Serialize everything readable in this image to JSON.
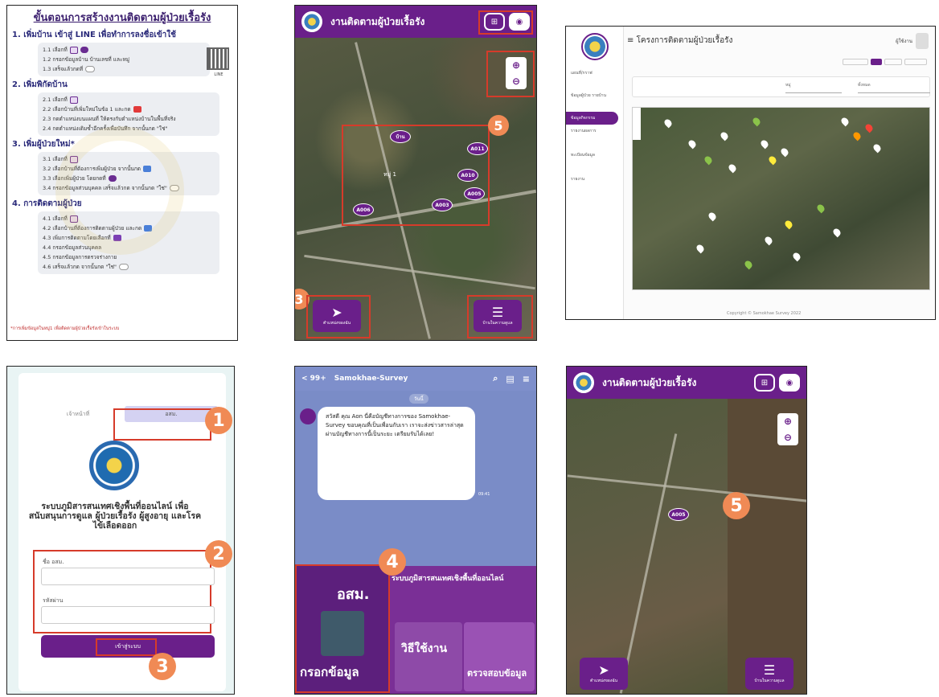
{
  "panel1": {
    "title": "ขั้นตอนการสร้างงานติดตามผู้ป่วยเรื้อรัง",
    "sections": [
      {
        "heading": "1. เพิ่มบ้าน เข้าสู่ LINE เพื่อทำการลงชื่อเข้าใช้",
        "steps": [
          "1.1 เลือกที่",
          "1.2 กรอกข้อมูลบ้าน บ้านเลขที่ และหมู่",
          "1.3 เสร็จแล้วกดที่"
        ]
      },
      {
        "heading": "2. เพิ่มพิกัดบ้าน",
        "steps": [
          "2.1 เลือกที่",
          "2.2 เลือกบ้านที่เพิ่มใหม่ในข้อ 1 และกด",
          "2.3 กดตำแหน่งบนแผนที่ ให้ตรงกับตำแหน่งบ้านในพื้นที่จริง",
          "2.4 กดตำแหน่งเดิมซ้ำอีกครั้งเพื่อบันทึก จากนั้นกด \"ใช่\""
        ]
      },
      {
        "heading": "3. เพิ่มผู้ป่วยใหม่*",
        "steps": [
          "3.1 เลือกที่",
          "3.2 เลือกบ้านที่ต้องการเพิ่มผู้ป่วย จากนั้นกด",
          "3.3 เลือกเพิ่มผู้ป่วย โดยกดที่",
          "3.4 กรอกข้อมูลส่วนบุคคล เสร็จแล้วกด จากนั้นกด \"ใช่\""
        ]
      },
      {
        "heading": "4. การติดตามผู้ป่วย",
        "steps": [
          "4.1 เลือกที่",
          "4.2 เลือกบ้านที่ต้องการติดตามผู้ป่วย และกด",
          "4.3 เพิ่มการติดตามโดยเลือกที่",
          "4.4 กรอกข้อมูลส่วนบุคคล",
          "4.5 กรอกข้อมูลการตรวจร่างกาย",
          "4.6 เสร็จแล้วกด จากนั้นกด \"ใช่\""
        ]
      }
    ],
    "footnote": "*การเพิ่มข้อมูลในหมู่1 เพื่อติดตามผู้ป่วยเรื้อรังเข้าในระบบ"
  },
  "panel2": {
    "app_title": "งานติดตามผู้ป่วยเรื้อรัง",
    "village_label": "หมู่ 1",
    "pins": [
      "บ้าน",
      "A011",
      "A010",
      "A005",
      "A003",
      "A006"
    ],
    "badges": [
      "5",
      "3"
    ],
    "nav_left": "ตำแหน่งของฉัน",
    "nav_right": "บ้านในความดูแล"
  },
  "panel3": {
    "header": "โครงการติดตามผู้ป่วยเรื้อรัง",
    "menu": [
      "แผนที่/กราฟ",
      "ข้อมูลผู้ป่วย รายบ้าน",
      "ข้อมูลกิจกรรม",
      "รายงานผลการ",
      "ทะเบียนข้อมูล",
      "รายงาน"
    ],
    "filter1": "หมู่",
    "filter2": "ทั้งหมด",
    "footer": "Copyright © Samokhae Survey 2022"
  },
  "panel4": {
    "tab1": "เจ้าหน้าที่",
    "tab2": "อสม.",
    "title": "ระบบภูมิสารสนเทศเชิงพื้นที่ออนไลน์ เพื่อสนับสนุนการดูแล ผู้ป่วยเรื้อรัง ผู้สูงอายุ และโรคไข้เลือดออก",
    "label_user": "ชื่อ อสม.",
    "label_pass": "รหัสผ่าน",
    "button": "เข้าสู่ระบบ",
    "badges": [
      "1",
      "2",
      "3"
    ]
  },
  "panel5": {
    "back": "< 99+",
    "chat_name": "Samokhae-Survey",
    "date": "วันนี้",
    "message": "สวัสดี คุณ Aon นี่คือบัญชีทางการของ Samokhae-Survey ขอบคุณที่เป็นเพื่อนกับเรา เราจะส่งข่าวสารล่าสุดผ่านบัญชีทางการนี้เป็นระยะ เตรียมรับได้เลย!",
    "time": "09:41",
    "promo_a": "อสม.",
    "promo_b": "กรอกข้อมูล",
    "promo_c": "วิธีใช้งาน",
    "promo_d": "ตรวจสอบข้อมูล",
    "promo_head": "ระบบภูมิสารสนเทศเชิงพื้นที่ออนไลน์",
    "badge": "4"
  },
  "panel6": {
    "app_title": "งานติดตามผู้ป่วยเรื้อรัง",
    "pin": "A005",
    "badge": "5",
    "nav_left": "ตำแหน่งของฉัน",
    "nav_right": "บ้านในความดูแล"
  }
}
